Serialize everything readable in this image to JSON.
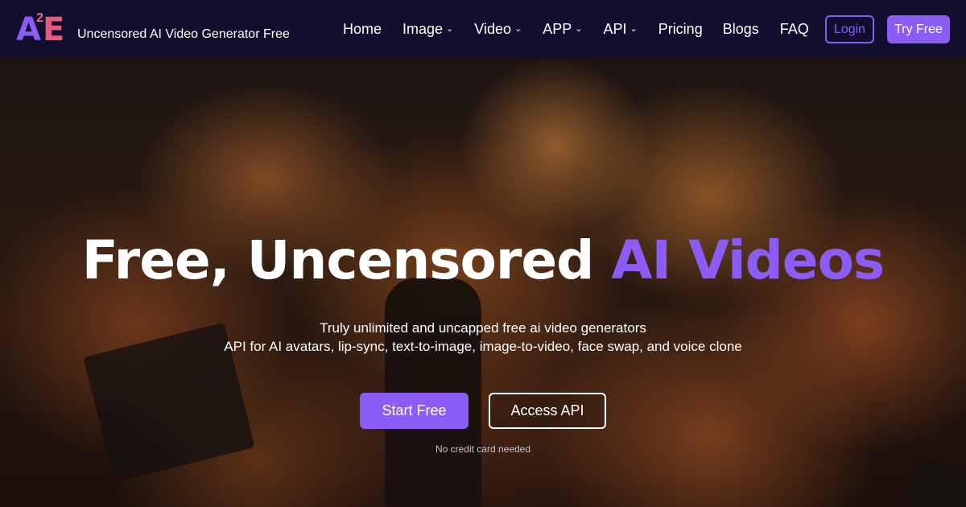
{
  "brand": {
    "logo_a": "A",
    "logo_sup": "2",
    "logo_e": "E",
    "tagline": "Uncensored AI Video Generator Free"
  },
  "nav": {
    "items": [
      {
        "label": "Home",
        "dropdown": false
      },
      {
        "label": "Image",
        "dropdown": true
      },
      {
        "label": "Video",
        "dropdown": true
      },
      {
        "label": "APP",
        "dropdown": true
      },
      {
        "label": "API",
        "dropdown": true
      },
      {
        "label": "Pricing",
        "dropdown": false
      },
      {
        "label": "Blogs",
        "dropdown": false
      },
      {
        "label": "FAQ",
        "dropdown": false
      }
    ],
    "login_label": "Login",
    "try_free_label": "Try Free"
  },
  "hero": {
    "title_main": "Free, Uncensored ",
    "title_accent": "AI Videos",
    "subtitle_line1": "Truly unlimited and uncapped free ai video generators",
    "subtitle_line2": "API for AI avatars, lip-sync, text-to-image, image-to-video, face swap, and voice clone",
    "start_label": "Start Free",
    "api_label": "Access API",
    "note": "No credit card needed"
  },
  "colors": {
    "accent": "#8b5cf6",
    "nav_bg": "#120f2e",
    "logo_pink": "#e75a7c"
  },
  "icons": {
    "dropdown": "chevron-down-icon"
  }
}
